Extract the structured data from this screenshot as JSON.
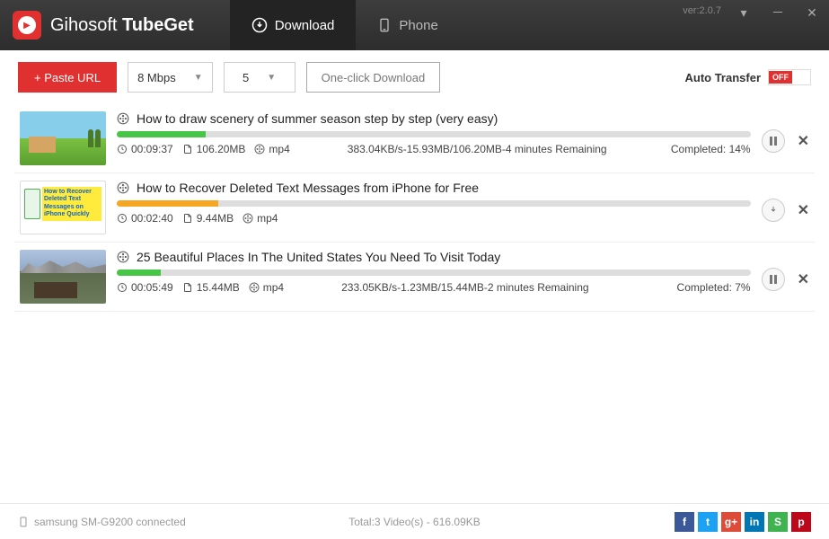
{
  "app": {
    "brand_light": "Gihosoft ",
    "brand_bold": "TubeGet",
    "version": "ver:2.0.7"
  },
  "tabs": {
    "download": "Download",
    "phone": "Phone"
  },
  "toolbar": {
    "paste": "+ Paste URL",
    "speed": "8 Mbps",
    "count": "5",
    "oneclick": "One-click Download",
    "auto_transfer_label": "Auto Transfer",
    "toggle_state": "OFF"
  },
  "items": [
    {
      "title": "How to draw scenery of summer season step by step (very easy)",
      "duration": "00:09:37",
      "size": "106.20MB",
      "format": "mp4",
      "speed": "383.04KB/s-15.93MB/106.20MB-4 minutes Remaining",
      "completed": "Completed:  14%",
      "progress": 14,
      "color": "#46c546",
      "action": "pause"
    },
    {
      "title": "How to Recover Deleted Text Messages from iPhone for Free",
      "duration": "00:02:40",
      "size": "9.44MB",
      "format": "mp4",
      "speed": "",
      "completed": "",
      "progress": 16,
      "color": "#f5a623",
      "action": "download"
    },
    {
      "title": "25 Beautiful Places In The United States You Need To Visit Today",
      "duration": "00:05:49",
      "size": "15.44MB",
      "format": "mp4",
      "speed": "233.05KB/s-1.23MB/15.44MB-2 minutes Remaining",
      "completed": "Completed:  7%",
      "progress": 7,
      "color": "#46c546",
      "action": "pause"
    }
  ],
  "footer": {
    "device": "samsung SM-G9200 connected",
    "totals": "Total:3 Video(s)   - 616.09KB"
  },
  "socials": [
    {
      "name": "facebook",
      "bg": "#3b5998",
      "label": "f"
    },
    {
      "name": "twitter",
      "bg": "#1da1f2",
      "label": "t"
    },
    {
      "name": "google-plus",
      "bg": "#dd4b39",
      "label": "g+"
    },
    {
      "name": "linkedin",
      "bg": "#0077b5",
      "label": "in"
    },
    {
      "name": "stumbleupon",
      "bg": "#3fb34f",
      "label": "S"
    },
    {
      "name": "pinterest",
      "bg": "#bd081c",
      "label": "p"
    }
  ]
}
